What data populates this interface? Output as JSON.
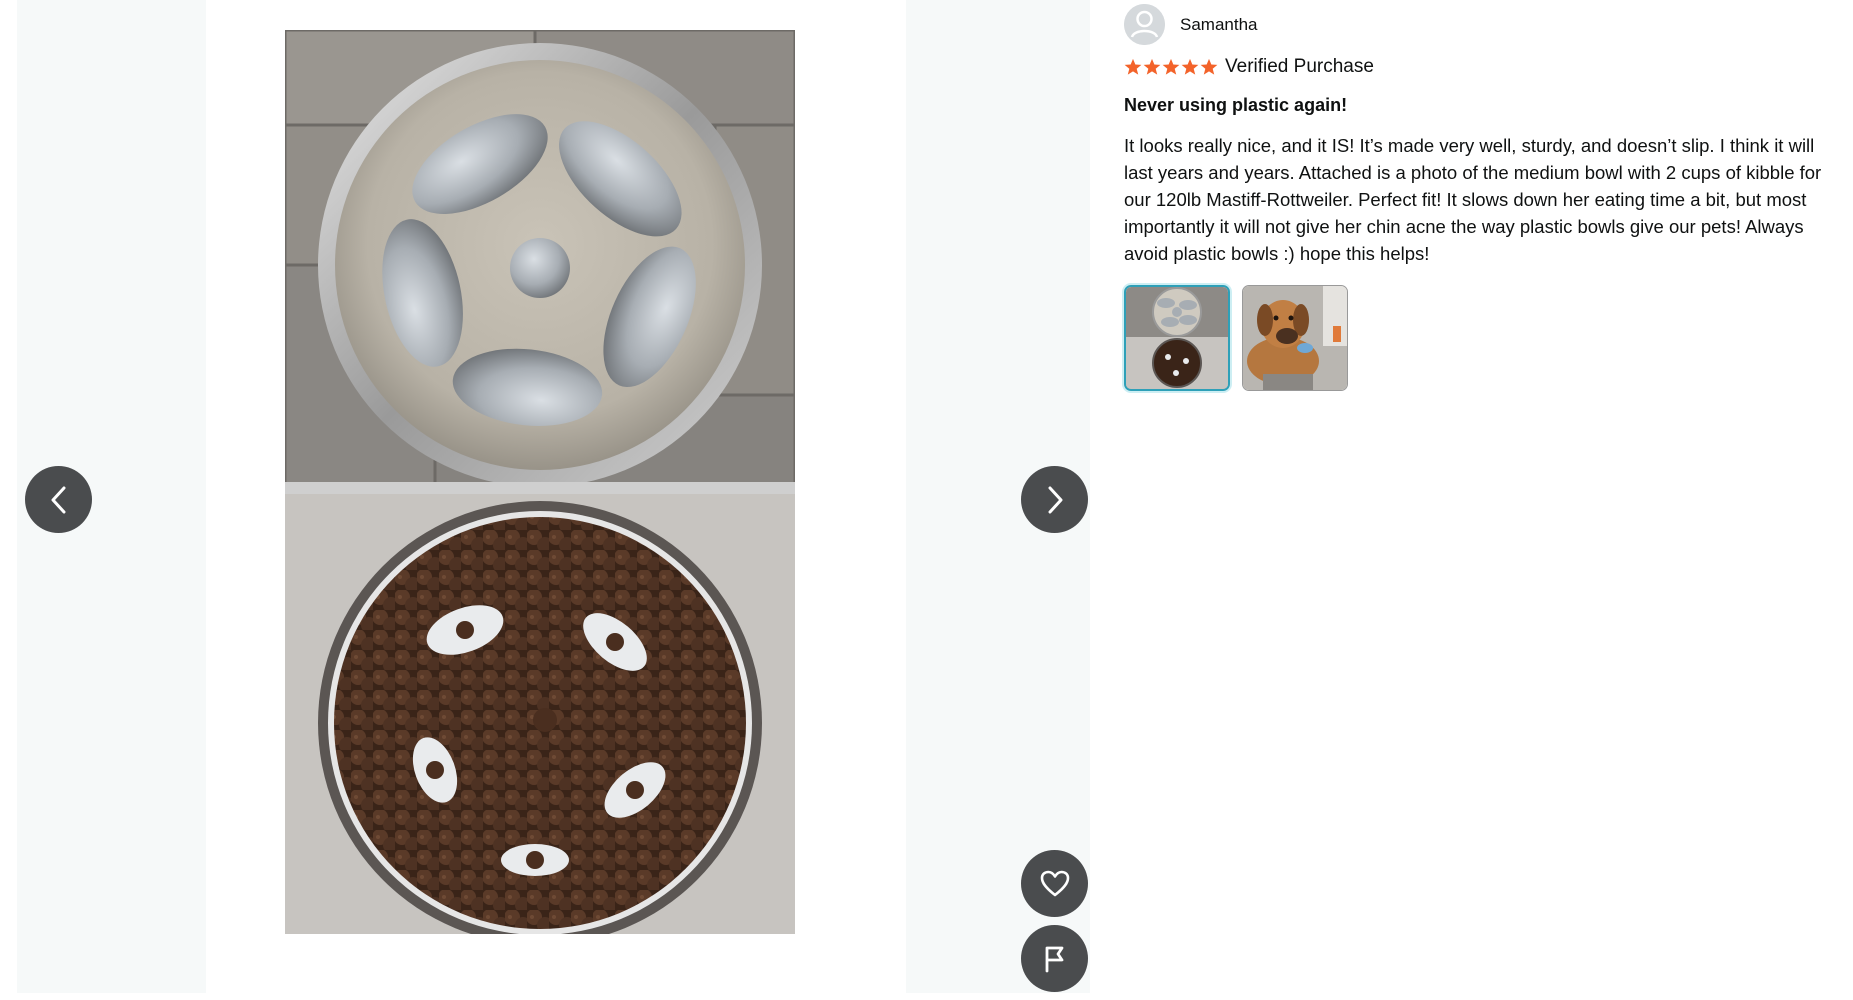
{
  "viewer": {
    "prev_icon": "chevron-left-icon",
    "next_icon": "chevron-right-icon",
    "like_icon": "heart-icon",
    "report_icon": "flag-icon",
    "image_description_icon": "slow-feeder-bowl-photo"
  },
  "review": {
    "reviewer_name": "Samantha",
    "avatar_icon": "user-avatar-icon",
    "rating": 5,
    "rating_max": 5,
    "star_color": "#f3632a",
    "verified_label": "Verified Purchase",
    "title": "Never using plastic again!",
    "body": "It looks really nice, and it IS! It’s made very well, sturdy, and doesn’t slip. I think it will last years and years. Attached is a photo of the medium bowl with 2 cups of kibble for our 120lb Mastiff-Rottweiler. Perfect fit! It slows down her eating time a bit, but most importantly it will not give her chin acne the way plastic bowls give our pets! Always avoid plastic bowls :) hope this helps!",
    "thumbnails": [
      {
        "icon": "bowl-thumbnail",
        "selected": true
      },
      {
        "icon": "dog-thumbnail",
        "selected": false
      }
    ]
  },
  "colors": {
    "nav_button": "#4a4c4e",
    "selected_thumb_border": "#2ea0b8",
    "viewer_background": "#f6f9f9"
  }
}
